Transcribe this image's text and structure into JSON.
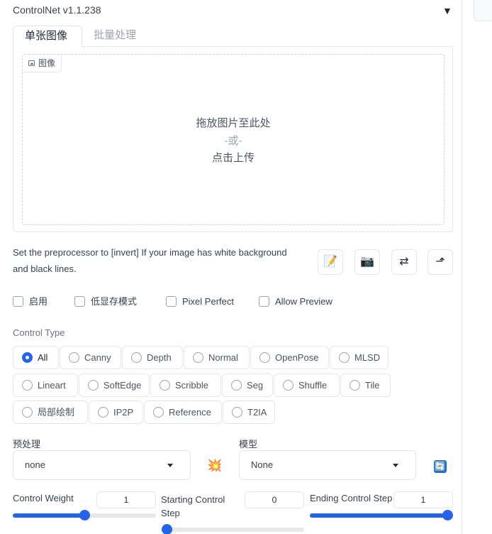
{
  "header": {
    "title": "ControlNet v1.1.238",
    "collapse_icon": "▼"
  },
  "tabs": [
    {
      "label": "单张图像",
      "active": true
    },
    {
      "label": "批量处理",
      "active": false
    }
  ],
  "image_input": {
    "label": "图像",
    "drop_text": "拖放图片至此处",
    "or_text": "-或-",
    "upload_text": "点击上传"
  },
  "hint": "Set the preprocessor to [invert] If your image has white background and black lines.",
  "tool_buttons": [
    {
      "name": "notepad-icon",
      "glyph": "📝"
    },
    {
      "name": "camera-icon",
      "glyph": "📷"
    },
    {
      "name": "swap-icon",
      "glyph": "⇄"
    },
    {
      "name": "send-dimensions-icon",
      "glyph": "⬏"
    }
  ],
  "checkboxes": [
    {
      "label": "启用",
      "checked": false
    },
    {
      "label": "低显存模式",
      "checked": false
    },
    {
      "label": "Pixel Perfect",
      "checked": false
    },
    {
      "label": "Allow Preview",
      "checked": false
    }
  ],
  "control_type": {
    "label": "Control Type",
    "selected": "All",
    "options": [
      "All",
      "Canny",
      "Depth",
      "Normal",
      "OpenPose",
      "MLSD",
      "Lineart",
      "SoftEdge",
      "Scribble",
      "Seg",
      "Shuffle",
      "Tile",
      "局部绘制",
      "IP2P",
      "Reference",
      "T2IA"
    ]
  },
  "preprocessor": {
    "label": "预处理",
    "value": "none",
    "run_icon": "💥"
  },
  "model": {
    "label": "模型",
    "value": "None",
    "refresh_icon": "🔄"
  },
  "sliders": {
    "control_weight": {
      "label": "Control Weight",
      "value": "1",
      "fraction": 0.5
    },
    "starting_step": {
      "label": "Starting Control Step",
      "value": "0",
      "fraction": 0.0
    },
    "ending_step": {
      "label": "Ending Control Step",
      "value": "1",
      "fraction": 1.0
    }
  },
  "colors": {
    "accent": "#2563eb",
    "border": "#e5e7eb",
    "muted": "#9ca3af"
  }
}
